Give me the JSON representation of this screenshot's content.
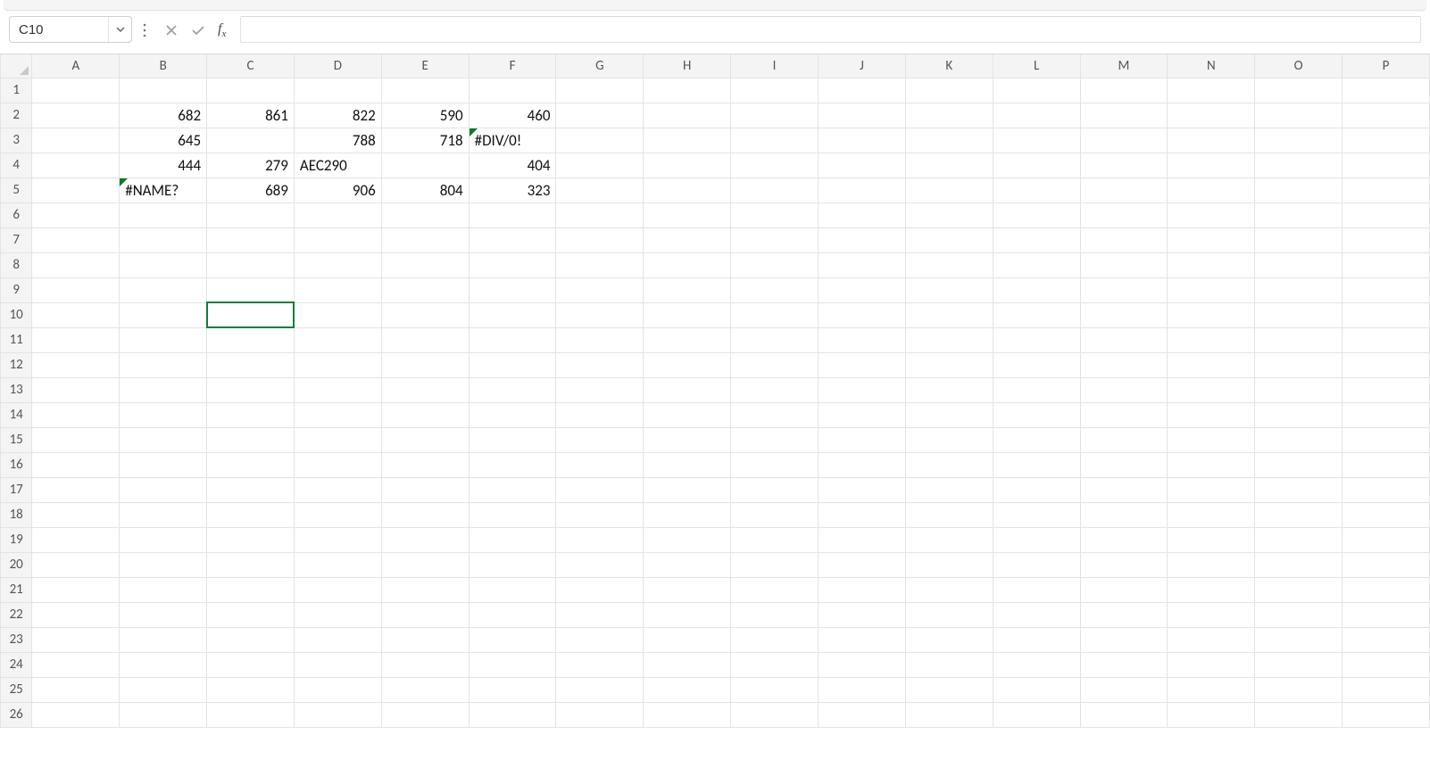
{
  "name_box": {
    "value": "C10"
  },
  "formula_bar": {
    "value": ""
  },
  "columns": [
    "A",
    "B",
    "C",
    "D",
    "E",
    "F",
    "G",
    "H",
    "I",
    "J",
    "K",
    "L",
    "M",
    "N",
    "O",
    "P"
  ],
  "row_count": 26,
  "active_cell": {
    "col": "C",
    "row": 10
  },
  "cells": {
    "B2": {
      "v": "682",
      "align": "right"
    },
    "C2": {
      "v": "861",
      "align": "right"
    },
    "D2": {
      "v": "822",
      "align": "right"
    },
    "E2": {
      "v": "590",
      "align": "right"
    },
    "F2": {
      "v": "460",
      "align": "right"
    },
    "B3": {
      "v": "645",
      "align": "right"
    },
    "D3": {
      "v": "788",
      "align": "right"
    },
    "E3": {
      "v": "718",
      "align": "right"
    },
    "F3": {
      "v": "#DIV/0!",
      "align": "left",
      "error": true
    },
    "B4": {
      "v": "444",
      "align": "right"
    },
    "C4": {
      "v": "279",
      "align": "right"
    },
    "D4": {
      "v": "AEC290",
      "align": "left"
    },
    "F4": {
      "v": "404",
      "align": "right"
    },
    "B5": {
      "v": "#NAME?",
      "align": "left",
      "error": true
    },
    "C5": {
      "v": "689",
      "align": "right"
    },
    "D5": {
      "v": "906",
      "align": "right"
    },
    "E5": {
      "v": "804",
      "align": "right"
    },
    "F5": {
      "v": "323",
      "align": "right"
    }
  }
}
